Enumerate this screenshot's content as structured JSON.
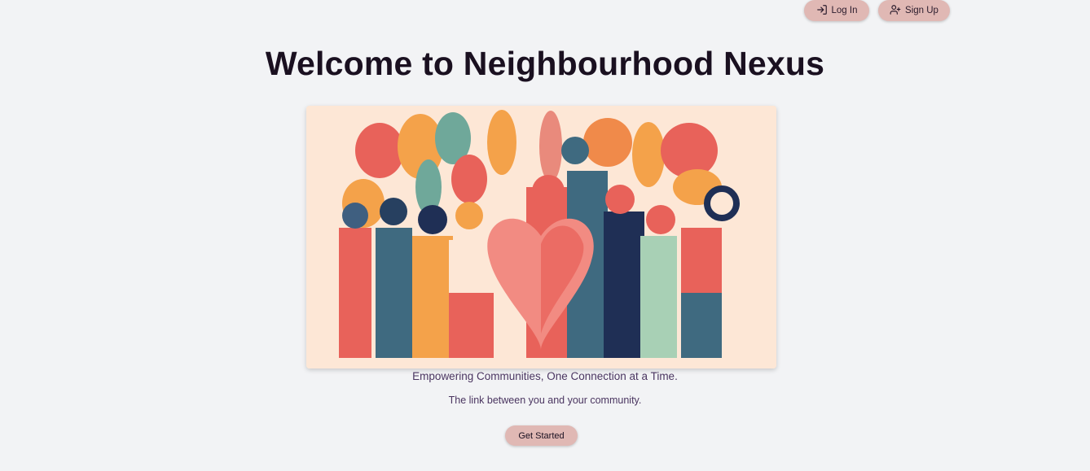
{
  "header": {
    "login_label": "Log In",
    "signup_label": "Sign Up"
  },
  "main": {
    "title": "Welcome to Neighbourhood Nexus",
    "tagline": "Empowering Communities, One Connection at a Time.",
    "subtitle": "The link between you and your community.",
    "cta_label": "Get Started"
  },
  "icons": {
    "login": "login-arrow-icon",
    "signup": "user-plus-icon"
  },
  "colors": {
    "background": "#f2f3f5",
    "button": "#e0b8b4",
    "title": "#1a1020",
    "text": "#4a3560",
    "hero_background": "#fde7d6"
  }
}
